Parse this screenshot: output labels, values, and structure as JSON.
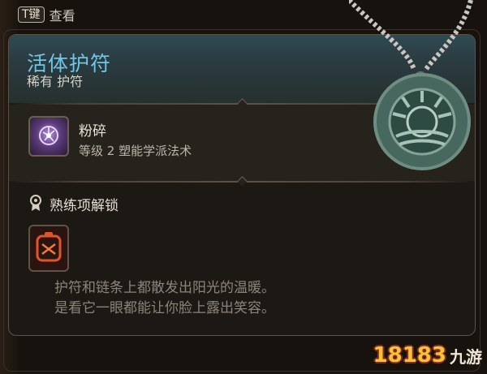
{
  "hint": {
    "key": "T键",
    "action": "查看"
  },
  "item": {
    "name": "活体护符",
    "rarity_type": "稀有 护符"
  },
  "spell": {
    "name": "粉碎",
    "meta": "等级 2 塑能学派法术",
    "icon": "shatter-spell-icon"
  },
  "unlock": {
    "label": "熟练项解锁",
    "icon": "proficiency-unlock-icon",
    "item_icon": "amulet-proficiency-icon"
  },
  "description": {
    "line1": "护符和链条上都散发出阳光的温暖。",
    "line2": "是看它一眼都能让你脸上露出笑容。"
  },
  "watermark": {
    "number": "18183",
    "text": "九游"
  },
  "colors": {
    "title": "#6fc7e6",
    "header_bg": "#2f4a52",
    "panel_bg": "#1c1915",
    "description": "#8b847a",
    "spell_icon_accent": "#b691e0",
    "item_icon_accent": "#e0542c"
  }
}
